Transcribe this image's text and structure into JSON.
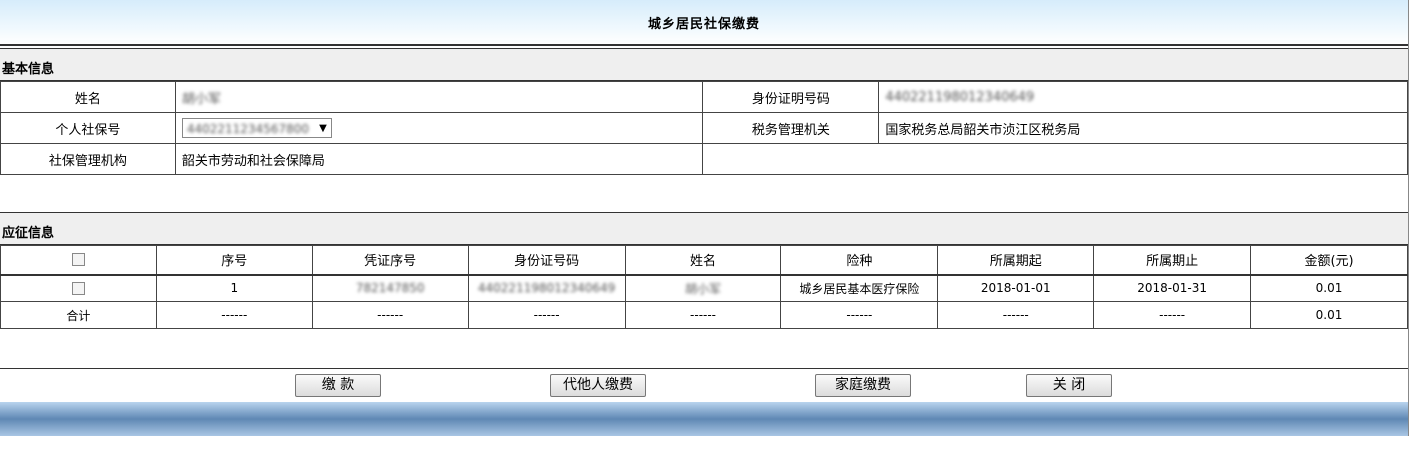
{
  "title": "城乡居民社保缴费",
  "basic": {
    "heading": "基本信息",
    "name_label": "姓名",
    "name_value": "胡小军",
    "idno_label": "身份证明号码",
    "idno_value": "440221198012340649",
    "ss_label": "个人社保号",
    "ss_value": "4402211234567800",
    "tax_label": "税务管理机关",
    "tax_value": "国家税务总局韶关市浈江区税务局",
    "org_label": "社保管理机构",
    "org_value": "韶关市劳动和社会保障局"
  },
  "levy": {
    "heading": "应征信息",
    "columns": [
      "序号",
      "凭证序号",
      "身份证号码",
      "姓名",
      "险种",
      "所属期起",
      "所属期止",
      "金额(元)"
    ],
    "rows": [
      {
        "seq": "1",
        "voucher": "782147850",
        "id": "440221198012340649",
        "name": "胡小军",
        "type": "城乡居民基本医疗保险",
        "start": "2018-01-01",
        "end": "2018-01-31",
        "amount": "0.01"
      }
    ],
    "total": {
      "label": "合计",
      "dash": "------",
      "amount": "0.01"
    }
  },
  "buttons": {
    "pay": "缴 款",
    "proxy": "代他人缴费",
    "family": "家庭缴费",
    "close": "关 闭"
  }
}
